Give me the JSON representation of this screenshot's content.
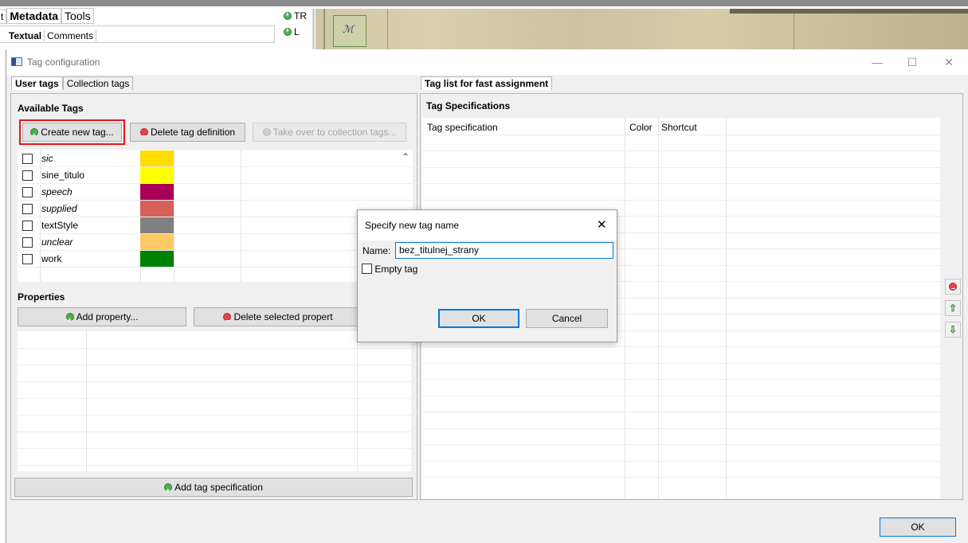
{
  "background_app": {
    "tabs_row1": [
      "t",
      "Metadata",
      "Tools"
    ],
    "tabs_row2": [
      "Textual",
      "Comments"
    ],
    "buttons": [
      "TR",
      "L"
    ]
  },
  "dialog": {
    "title": "Tag configuration",
    "window_controls": {
      "minimize": "—",
      "maximize": "☐",
      "close": "✕"
    },
    "left_tabs": [
      "User tags",
      "Collection tags"
    ],
    "available_tags_label": "Available Tags",
    "buttons": {
      "create": "Create new tag...",
      "delete": "Delete tag definition",
      "take_over": "Take over to collection tags..."
    },
    "tags": [
      {
        "name": "sic",
        "italic": true,
        "color": "#ffdd00"
      },
      {
        "name": "sine_titulo",
        "italic": false,
        "color": "#ffff00"
      },
      {
        "name": "speech",
        "italic": true,
        "color": "#a8005a"
      },
      {
        "name": "supplied",
        "italic": true,
        "color": "#d65f5a"
      },
      {
        "name": "textStyle",
        "italic": false,
        "color": "#808080"
      },
      {
        "name": "unclear",
        "italic": true,
        "color": "#ffc966"
      },
      {
        "name": "work",
        "italic": false,
        "color": "#008000"
      }
    ],
    "properties_label": "Properties",
    "add_property": "Add property...",
    "delete_property": "Delete selected propert",
    "add_tag_spec": "Add tag specification",
    "right_tab": "Tag list for fast assignment",
    "tag_specs_label": "Tag Specifications",
    "spec_columns": [
      "Tag specification",
      "Color",
      "Shortcut"
    ],
    "ok": "OK"
  },
  "new_tag_dialog": {
    "title": "Specify new tag name",
    "close": "✕",
    "name_label": "Name:",
    "name_value": "bez_titulnej_strany",
    "empty_tag_label": "Empty tag",
    "ok": "OK",
    "cancel": "Cancel"
  }
}
